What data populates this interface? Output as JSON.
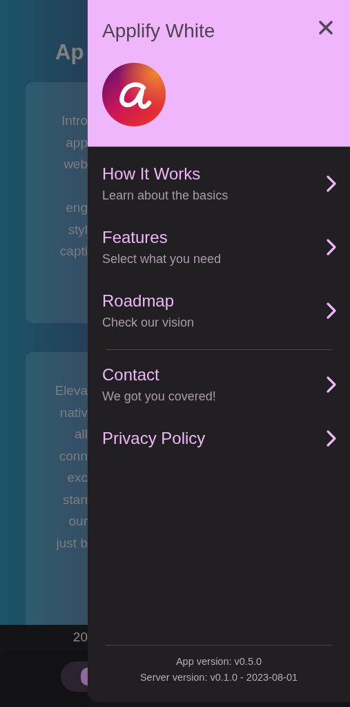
{
  "background_page": {
    "heading": "Ap",
    "cards": [
      {
        "paragraphs": [
          [
            "Intro",
            "app",
            "web"
          ],
          [
            "eng",
            "styl",
            "capti"
          ]
        ]
      },
      {
        "paragraphs": [
          [
            "Eleva",
            "nativ",
            "all",
            "conn",
            "exc",
            "stan",
            "our",
            "just b"
          ]
        ]
      }
    ],
    "footer_text": "20"
  },
  "drawer": {
    "title": "Applify White",
    "item_groups": [
      [
        {
          "title": "How It Works",
          "subtitle": "Learn about the basics"
        },
        {
          "title": "Features",
          "subtitle": "Select what you need"
        },
        {
          "title": "Roadmap",
          "subtitle": "Check our vision"
        }
      ],
      [
        {
          "title": "Contact",
          "subtitle": "We got you covered!"
        },
        {
          "title": "Privacy Policy"
        }
      ]
    ],
    "footer": [
      "App version: v0.5.0",
      "Server version: v0.1.0 - 2023-08-01"
    ]
  }
}
